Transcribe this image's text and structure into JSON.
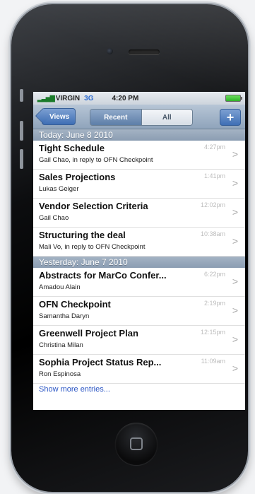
{
  "status": {
    "carrier": "VIRGIN",
    "network": "3G",
    "time": "4:20 PM"
  },
  "nav": {
    "back_label": "Views",
    "segments": [
      "Recent",
      "All"
    ],
    "add_label": "+"
  },
  "sections": [
    {
      "header": "Today: June 8 2010",
      "items": [
        {
          "title": "Tight Schedule",
          "subtitle": "Gail Chao, in reply to OFN Checkpoint",
          "time": "4:27pm"
        },
        {
          "title": "Sales Projections",
          "subtitle": "Lukas Geiger",
          "time": "1:41pm"
        },
        {
          "title": "Vendor Selection Criteria",
          "subtitle": "Gail Chao",
          "time": "12:02pm"
        },
        {
          "title": "Structuring the deal",
          "subtitle": "Mali Vo, in reply to OFN Checkpoint",
          "time": "10:38am"
        }
      ]
    },
    {
      "header": "Yesterday: June 7 2010",
      "items": [
        {
          "title": "Abstracts for MarCo Confer...",
          "subtitle": "Amadou Alain",
          "time": "6:22pm"
        },
        {
          "title": "OFN Checkpoint",
          "subtitle": "Samantha Daryn",
          "time": "2:19pm"
        },
        {
          "title": "Greenwell Project Plan",
          "subtitle": "Christina Milan",
          "time": "12:15pm"
        },
        {
          "title": "Sophia Project Status Rep...",
          "subtitle": "Ron Espinosa",
          "time": "11:09am"
        }
      ]
    }
  ],
  "footer": {
    "more_label": "Show more entries..."
  },
  "icons": {
    "chevron": "chevron-right-icon",
    "signal": "signal-icon",
    "battery": "battery-icon"
  }
}
